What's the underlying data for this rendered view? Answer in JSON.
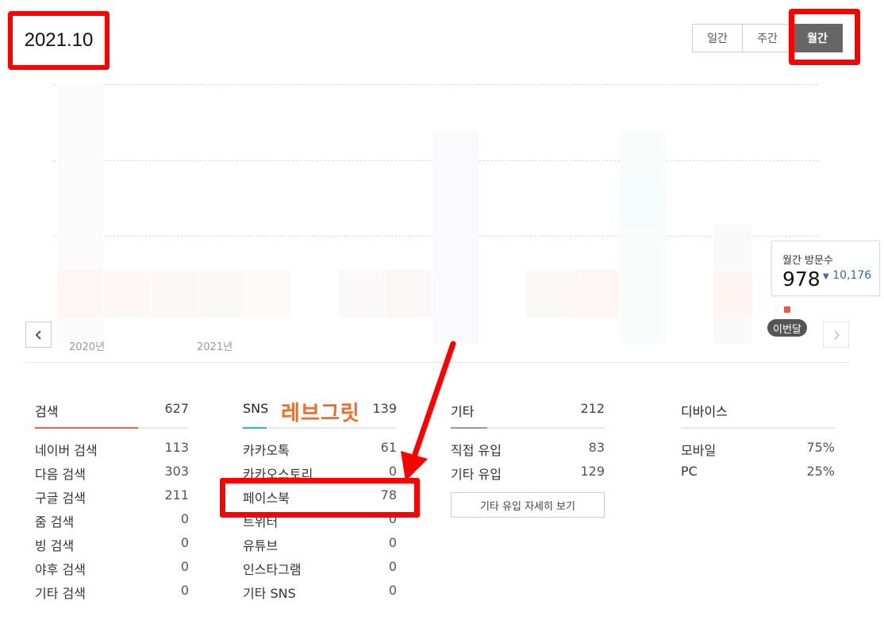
{
  "header": {
    "period": "2021.10",
    "tabs": [
      {
        "label": "일간",
        "active": false
      },
      {
        "label": "주간",
        "active": false
      },
      {
        "label": "월간",
        "active": true
      }
    ]
  },
  "chart": {
    "x_labels": [
      "2020년",
      "2021년"
    ],
    "tooltip": {
      "label": "월간 방문수",
      "value": "978",
      "change": "10,176",
      "change_direction": "down"
    },
    "current_badge": "이번달",
    "prev_icon": "chevron-left-icon",
    "next_icon": "chevron-right-icon"
  },
  "annotation": {
    "text": "레브그릿"
  },
  "columns": {
    "search": {
      "title": "검색",
      "total": "627",
      "rows": [
        {
          "label": "네이버 검색",
          "value": "113"
        },
        {
          "label": "다음 검색",
          "value": "303"
        },
        {
          "label": "구글 검색",
          "value": "211"
        },
        {
          "label": "줌 검색",
          "value": "0"
        },
        {
          "label": "빙 검색",
          "value": "0"
        },
        {
          "label": "야후 검색",
          "value": "0"
        },
        {
          "label": "기타 검색",
          "value": "0"
        }
      ]
    },
    "sns": {
      "title": "SNS",
      "total": "139",
      "rows": [
        {
          "label": "카카오톡",
          "value": "61"
        },
        {
          "label": "카카오스토리",
          "value": "0"
        },
        {
          "label": "페이스북",
          "value": "78"
        },
        {
          "label": "트위터",
          "value": "0"
        },
        {
          "label": "유튜브",
          "value": "0"
        },
        {
          "label": "인스타그램",
          "value": "0"
        },
        {
          "label": "기타 SNS",
          "value": "0"
        }
      ]
    },
    "etc": {
      "title": "기타",
      "total": "212",
      "rows": [
        {
          "label": "직접 유입",
          "value": "83"
        },
        {
          "label": "기타 유입",
          "value": "129"
        }
      ],
      "detail_button": "기타 유입 자세히 보기"
    },
    "device": {
      "title": "디바이스",
      "rows": [
        {
          "label": "모바일",
          "value": "75%"
        },
        {
          "label": "PC",
          "value": "25%"
        }
      ]
    }
  },
  "colors": {
    "search_accent": "#e8624f",
    "sns_accent": "#2bbcb0",
    "etc_accent": "#999999",
    "highlight": "#ff0000",
    "annotation": "#f26b2a"
  }
}
